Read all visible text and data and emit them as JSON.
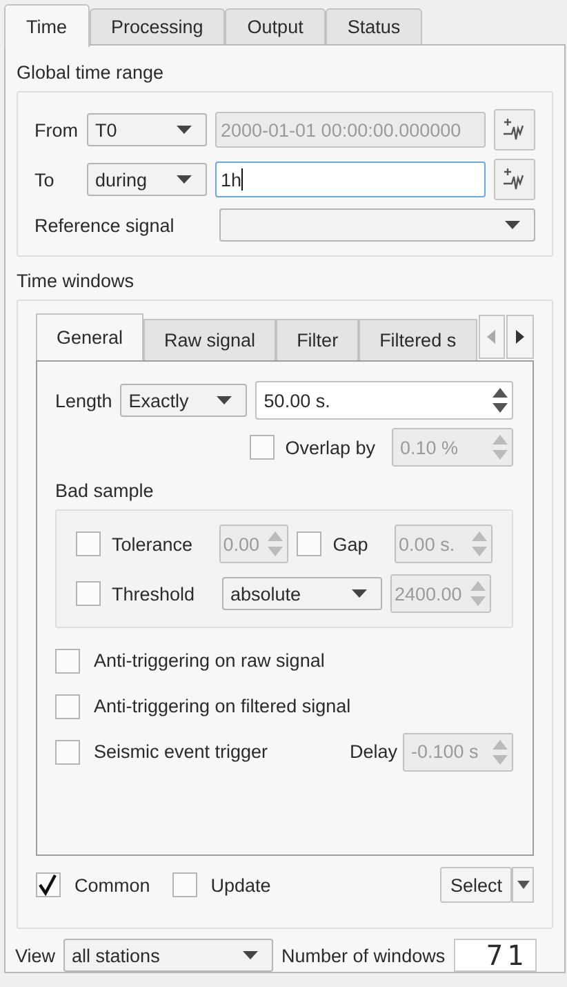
{
  "tabs": [
    {
      "label": "Time",
      "selected": true
    },
    {
      "label": "Processing",
      "selected": false
    },
    {
      "label": "Output",
      "selected": false
    },
    {
      "label": "Status",
      "selected": false
    }
  ],
  "global_time_range": {
    "title": "Global time range",
    "from": {
      "label": "From",
      "mode": "T0",
      "value": "2000-01-01 00:00:00.000000",
      "disabled": true
    },
    "to": {
      "label": "To",
      "mode": "during",
      "value": "1h",
      "disabled": false
    },
    "reference_signal": {
      "label": "Reference signal"
    }
  },
  "time_windows": {
    "title": "Time windows",
    "tabs": [
      {
        "label": "General",
        "selected": true
      },
      {
        "label": "Raw signal",
        "selected": false
      },
      {
        "label": "Filter",
        "selected": false
      },
      {
        "label": "Filtered s",
        "selected": false
      }
    ],
    "length": {
      "label": "Length",
      "mode": "Exactly",
      "value": "50.00 s."
    },
    "overlap": {
      "label": "Overlap by",
      "checked": false,
      "value": "0.10 %",
      "disabled": true
    },
    "bad_sample": {
      "title": "Bad sample",
      "tolerance": {
        "label": "Tolerance",
        "checked": false,
        "value": "0.00",
        "disabled": true
      },
      "gap": {
        "label": "Gap",
        "checked": false,
        "value": "0.00 s.",
        "disabled": true
      },
      "threshold": {
        "label": "Threshold",
        "checked": false,
        "mode": "absolute",
        "value": "2400.00",
        "disabled": true
      }
    },
    "options": [
      {
        "label": "Anti-triggering on raw signal",
        "checked": false
      },
      {
        "label": "Anti-triggering on filtered signal",
        "checked": false
      }
    ],
    "seismic_trigger": {
      "label": "Seismic event trigger",
      "checked": false
    },
    "delay": {
      "label": "Delay",
      "value": "-0.100 s",
      "disabled": true
    },
    "common": {
      "label": "Common",
      "checked": true
    },
    "update": {
      "label": "Update",
      "checked": false
    },
    "select_button": "Select"
  },
  "view": {
    "label": "View",
    "value": "all stations"
  },
  "number_of_windows": {
    "label": "Number of windows",
    "value": "71"
  }
}
